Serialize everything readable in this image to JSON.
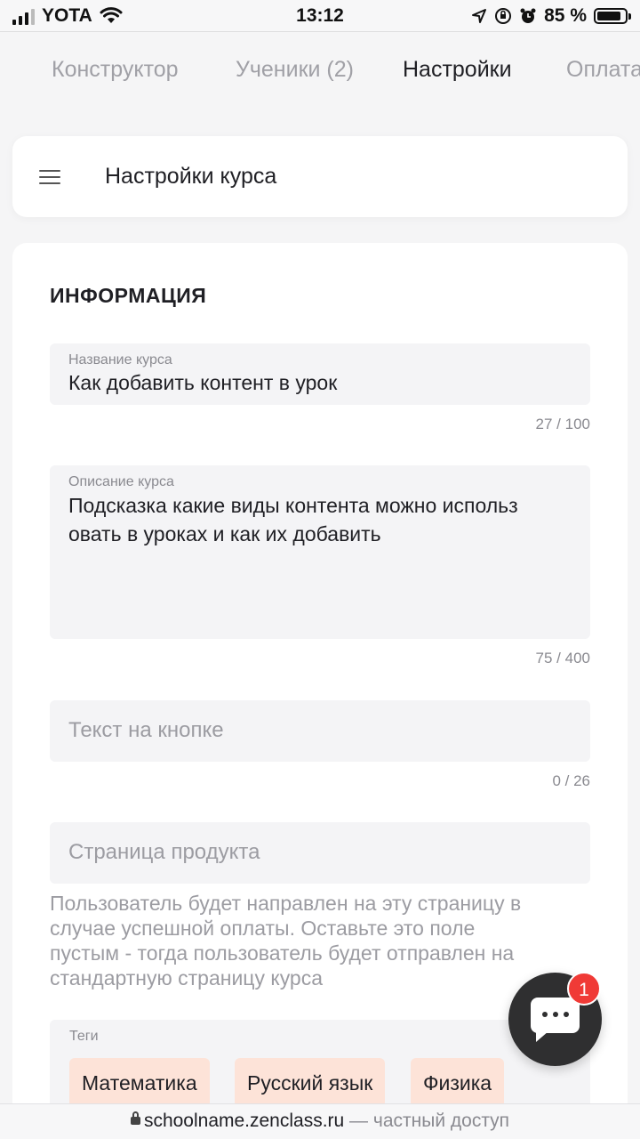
{
  "status_bar": {
    "carrier": "YOTA",
    "time": "13:12",
    "battery_percent": "85 %",
    "battery_level": 0.85
  },
  "tabs": [
    {
      "label": "Конструктор",
      "active": false
    },
    {
      "label": "Ученики (2)",
      "active": false
    },
    {
      "label": "Настройки",
      "active": true
    },
    {
      "label": "Оплата",
      "active": false
    }
  ],
  "header": {
    "menu_icon": "hamburger-icon",
    "title": "Настройки курса"
  },
  "info": {
    "section_title": "ИНФОРМАЦИЯ",
    "course_name": {
      "label": "Название курса",
      "value": "Как добавить контент в урок",
      "counter": "27 / 100"
    },
    "course_description": {
      "label": "Описание курса",
      "value_line1": "Подсказка какие виды контента можно использ",
      "value_line2": "овать в уроках и как их добавить",
      "counter": "75 / 400"
    },
    "button_text": {
      "placeholder": "Текст на кнопке",
      "counter": "0 / 26"
    },
    "product_page": {
      "placeholder": "Страница продукта",
      "hint_lines": [
        "Пользователь будет направлен на эту страницу в",
        "случае успешной оплаты. Оставьте это поле",
        "пустым - тогда пользователь будет отправлен на",
        "стандартную страницу курса"
      ]
    },
    "tags": {
      "label": "Теги",
      "items": [
        "Математика",
        "Русский язык",
        "Физика"
      ]
    }
  },
  "chat": {
    "icon": "chat-bubble-icon",
    "badge_count": "1"
  },
  "url_bar": {
    "domain": "schoolname.zenclass.ru",
    "suffix": " — частный доступ"
  },
  "colors": {
    "tag_background": "#fde3d8",
    "badge_red": "#f03a36",
    "chat_fab": "#2f2f30"
  }
}
